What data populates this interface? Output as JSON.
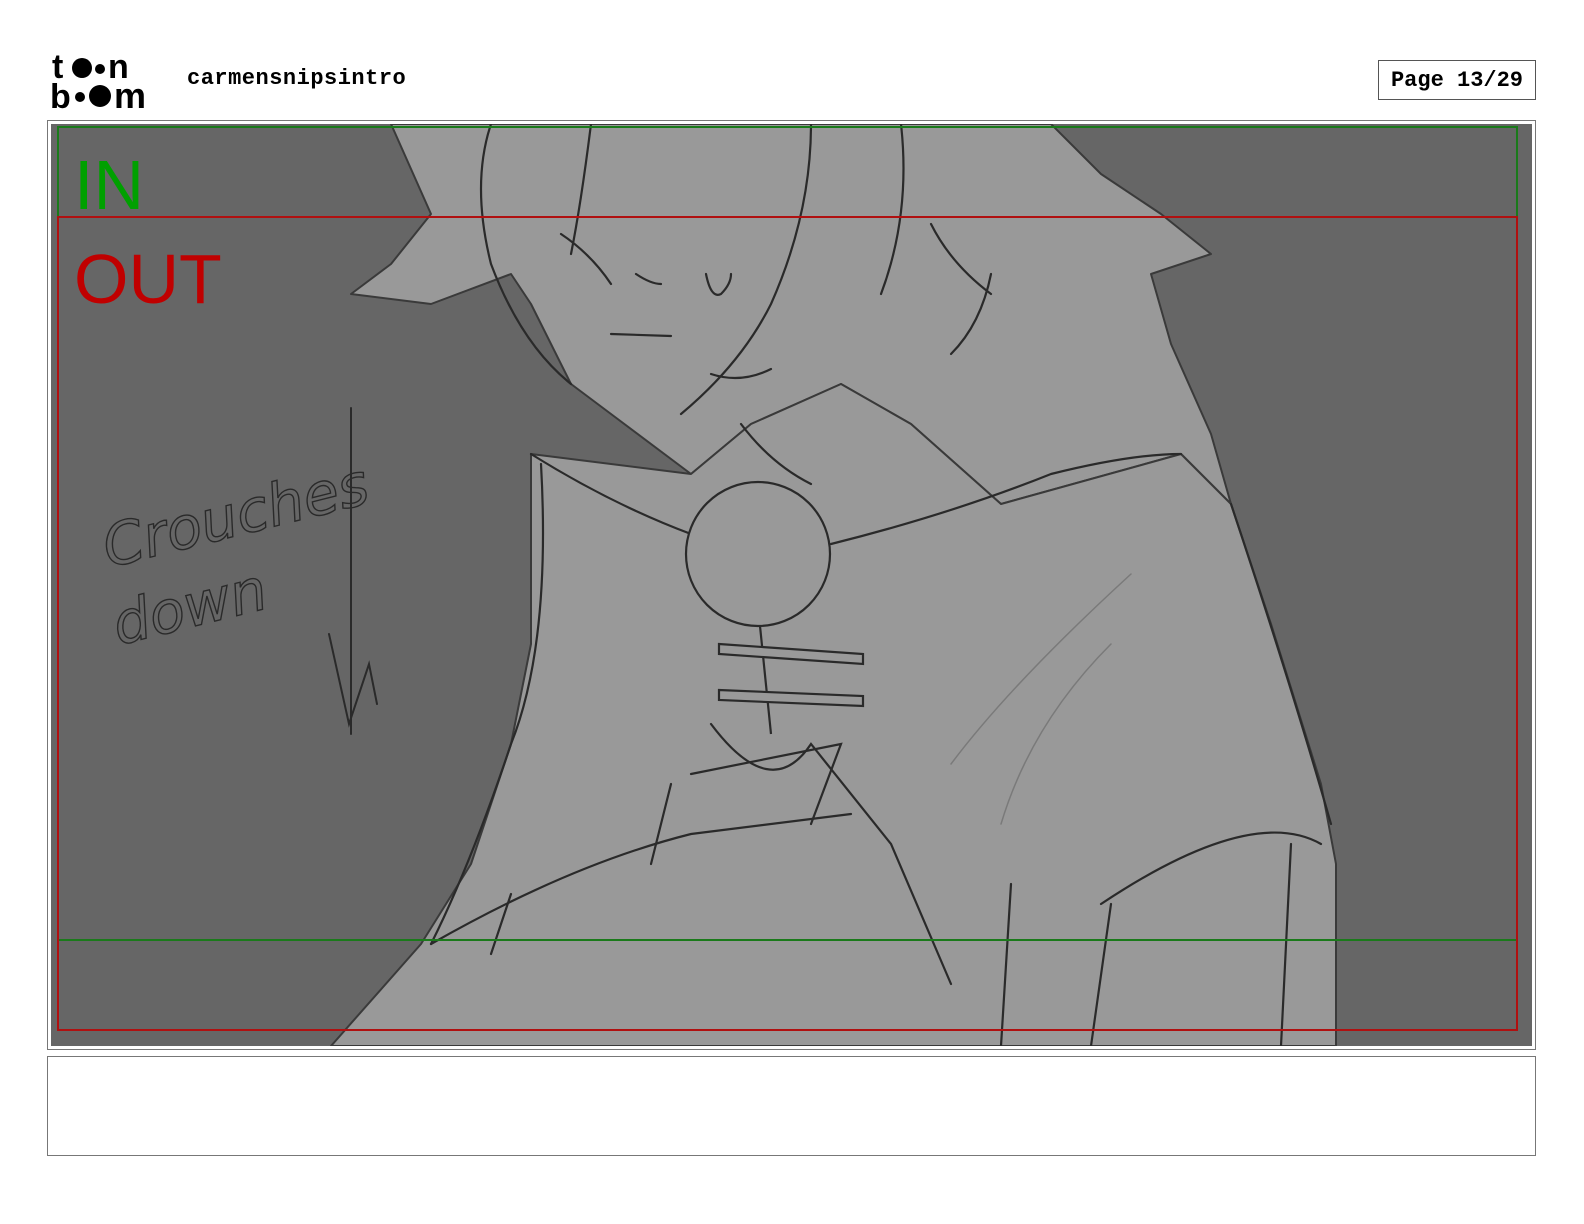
{
  "header": {
    "logo_text": "toon boom",
    "project_title": "carmensnipsintro",
    "page_label": "Page 13/29"
  },
  "panel": {
    "in_label": "IN",
    "out_label": "OUT",
    "handwritten_note": "Crouches down",
    "colors": {
      "background": "#666666",
      "figure": "#999999",
      "in_frame": "#1a7a1a",
      "out_frame": "#b01010"
    }
  },
  "caption": {
    "text": ""
  }
}
